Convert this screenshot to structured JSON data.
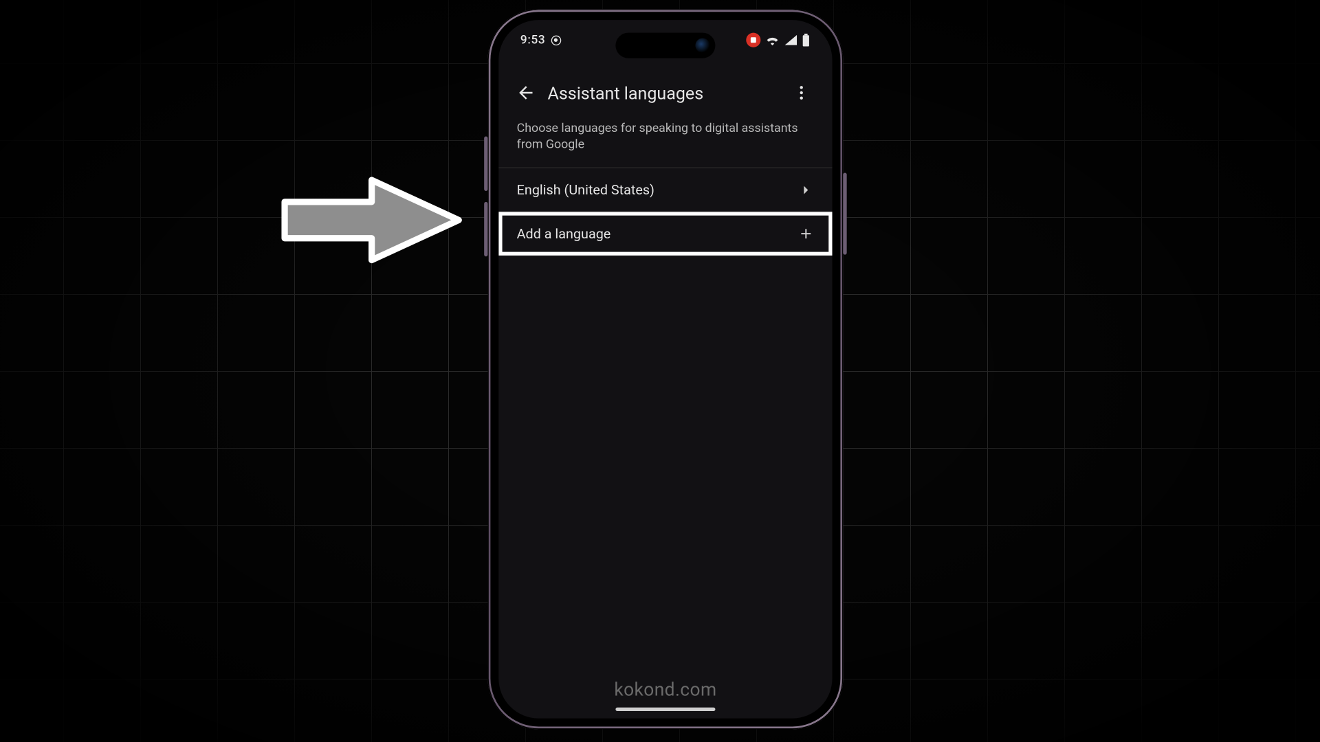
{
  "statusbar": {
    "time": "9:53"
  },
  "appbar": {
    "title": "Assistant languages"
  },
  "subtitle": "Choose languages for speaking to digital assistants from Google",
  "rows": {
    "language": "English (United States)",
    "add": "Add a language"
  },
  "watermark": "kokond.com"
}
